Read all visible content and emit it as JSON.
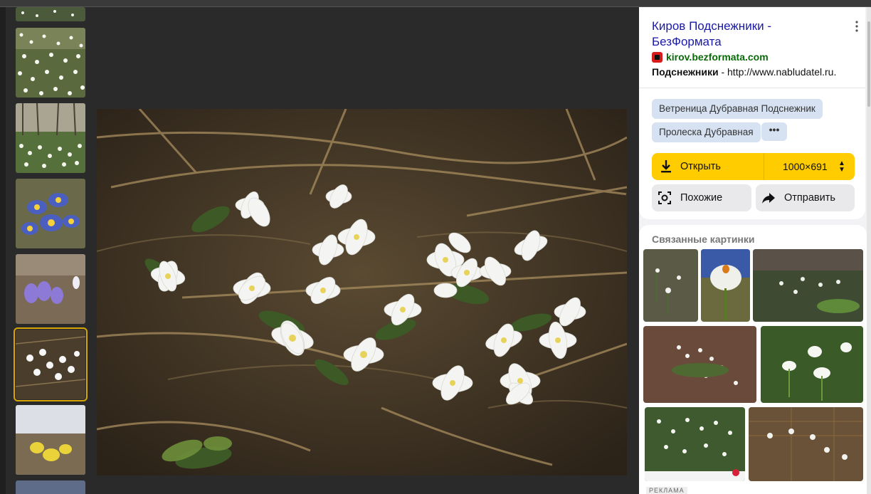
{
  "thumbnails": [
    {
      "name": "thumb-snowdrops-field-top",
      "selected": false
    },
    {
      "name": "thumb-snowdrops-meadow",
      "selected": false
    },
    {
      "name": "thumb-snowdrops-forest",
      "selected": false
    },
    {
      "name": "thumb-blue-crocus",
      "selected": false
    },
    {
      "name": "thumb-purple-crocus",
      "selected": false
    },
    {
      "name": "thumb-anemones",
      "selected": true
    },
    {
      "name": "thumb-yellow-flowers",
      "selected": false
    },
    {
      "name": "thumb-next",
      "selected": false
    }
  ],
  "panel": {
    "title": "Киров Подснежники - БезФормата",
    "more_icon": "vertical-dots-icon",
    "source_domain": "kirov.bezformata.com",
    "snippet_bold": "Подснежники",
    "snippet_rest": " - http://www.nabludatel.ru.",
    "tags": [
      "Ветреница Дубравная Подснежник",
      "Пролеска Дубравная"
    ],
    "tags_more": "•••",
    "open_label": "Открыть",
    "size_label": "1000×691",
    "similar_label": "Похожие",
    "share_label": "Отправить",
    "related_title": "Связанные картинки",
    "ad_label": "РЕКЛАМА"
  },
  "colors": {
    "accent": "#ffcc00",
    "link": "#1a1aa6",
    "domain": "#0a6a0a",
    "tag_bg": "#d6e2f2",
    "selected_outline": "#d8a400"
  }
}
